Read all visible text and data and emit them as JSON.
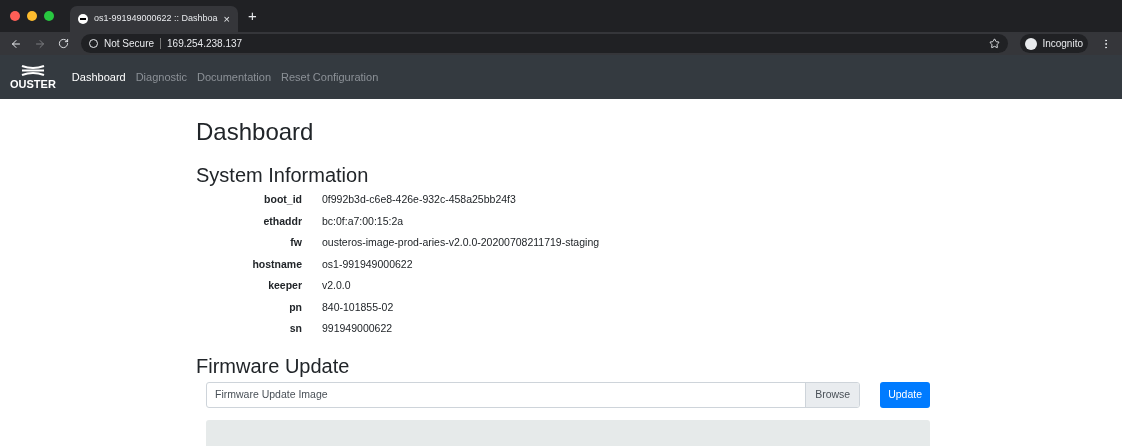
{
  "browser": {
    "tab_title": "os1-991949000622 :: Dashboa",
    "tab_close": "×",
    "new_tab": "+",
    "security": "Not Secure",
    "url": "169.254.238.137",
    "profile": "Incognito"
  },
  "navbar": {
    "brand": "OUSTER",
    "items": [
      {
        "label": "Dashboard",
        "selected": true
      },
      {
        "label": "Diagnostic",
        "selected": false
      },
      {
        "label": "Documentation",
        "selected": false
      },
      {
        "label": "Reset Configuration",
        "selected": false
      }
    ]
  },
  "page_title": "Dashboard",
  "system_information": {
    "title": "System Information",
    "rows": [
      {
        "key": "boot_id",
        "value": "0f992b3d-c6e8-426e-932c-458a25bb24f3"
      },
      {
        "key": "ethaddr",
        "value": "bc:0f:a7:00:15:2a"
      },
      {
        "key": "fw",
        "value": "ousteros-image-prod-aries-v2.0.0-20200708211719-staging"
      },
      {
        "key": "hostname",
        "value": "os1-991949000622"
      },
      {
        "key": "keeper",
        "value": "v2.0.0"
      },
      {
        "key": "pn",
        "value": "840-101855-02"
      },
      {
        "key": "sn",
        "value": "991949000622"
      }
    ]
  },
  "firmware_update": {
    "title": "Firmware Update",
    "file_placeholder": "Firmware Update Image",
    "browse": "Browse",
    "update": "Update"
  }
}
